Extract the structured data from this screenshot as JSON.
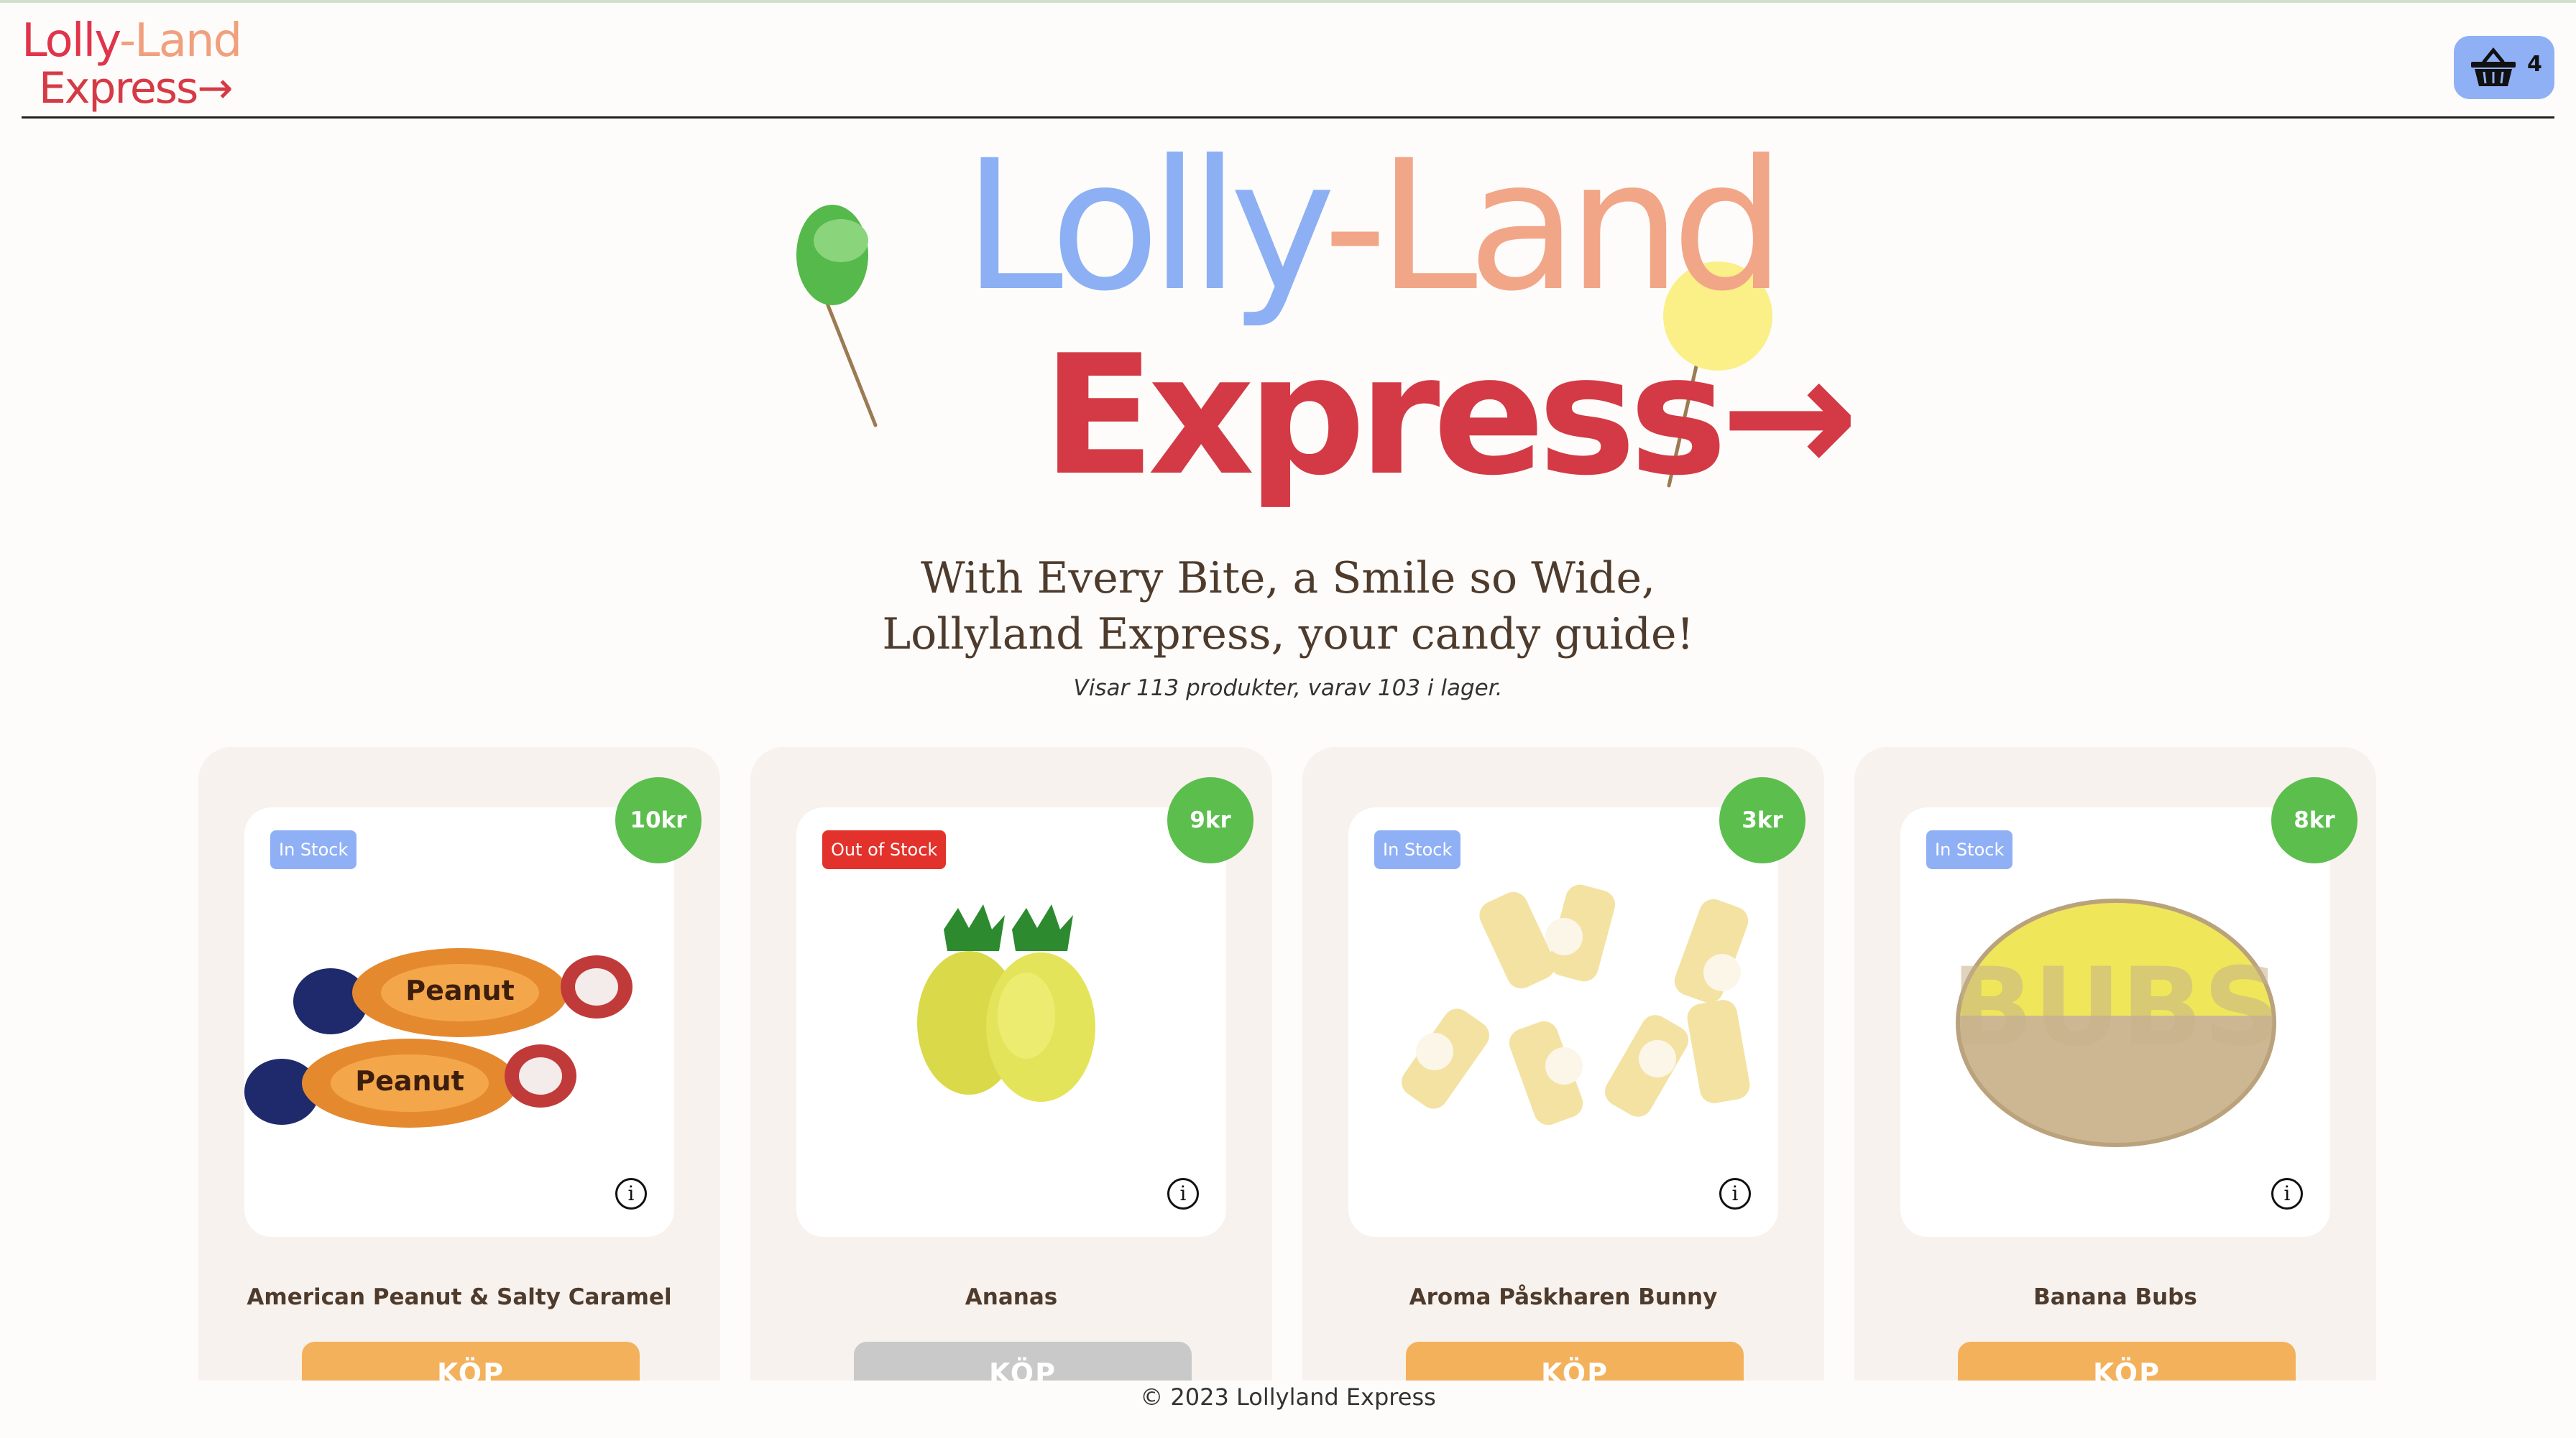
{
  "header": {
    "logo_line1_a": "Lolly",
    "logo_line1_b": "-Land",
    "logo_line2": "Express→",
    "cart_count": "4",
    "cart_icon": "basket-icon"
  },
  "hero": {
    "title_a": "Lolly",
    "title_b": "-Land",
    "title_line2": "Express→",
    "tagline_line1": "With Every Bite, a Smile so Wide,",
    "tagline_line2": "Lollyland Express, your candy guide!",
    "product_count": "Visar 113 produkter, varav 103 i lager."
  },
  "products": [
    {
      "name": "American Peanut & Salty Caramel",
      "price": "10kr",
      "stock": "In Stock",
      "in_stock": true,
      "buy_label": "KÖP"
    },
    {
      "name": "Ananas",
      "price": "9kr",
      "stock": "Out of Stock",
      "in_stock": false,
      "buy_label": "KÖP"
    },
    {
      "name": "Aroma Påskharen Bunny",
      "price": "3kr",
      "stock": "In Stock",
      "in_stock": true,
      "buy_label": "KÖP"
    },
    {
      "name": "Banana Bubs",
      "price": "8kr",
      "stock": "In Stock",
      "in_stock": true,
      "buy_label": "KÖP"
    }
  ],
  "footer": {
    "text": "© 2023 Lollyland Express"
  },
  "colors": {
    "brand_blue": "#8cb0f3",
    "brand_peach": "#f2a688",
    "brand_red": "#d33a45",
    "price_green": "#5bbe4d",
    "buy_orange": "#f4b15b",
    "out_of_stock_red": "#e2322b"
  }
}
